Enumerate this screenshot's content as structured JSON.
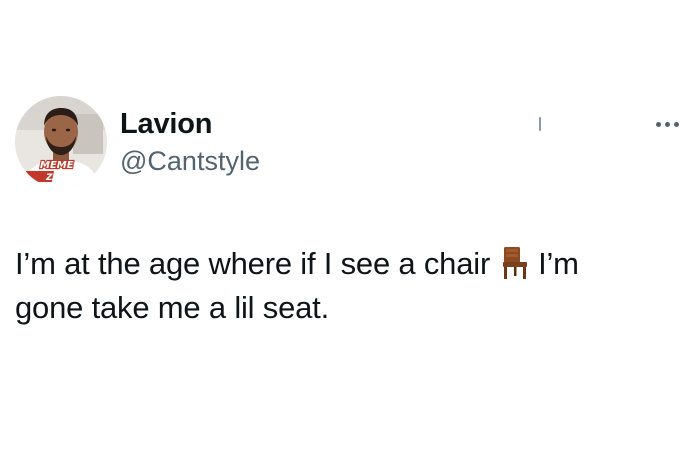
{
  "tweet": {
    "author": {
      "display_name": "Lavion",
      "handle": "@Cantstyle",
      "avatar_watermark": [
        "MEME",
        "ZAR"
      ]
    },
    "text": {
      "before_emoji": "I’m at the age where if I see a chair",
      "emoji": "chair-icon",
      "after_emoji": "I’m",
      "line2": "gone take me a lil seat."
    },
    "menu_icon": "more-options-icon"
  }
}
